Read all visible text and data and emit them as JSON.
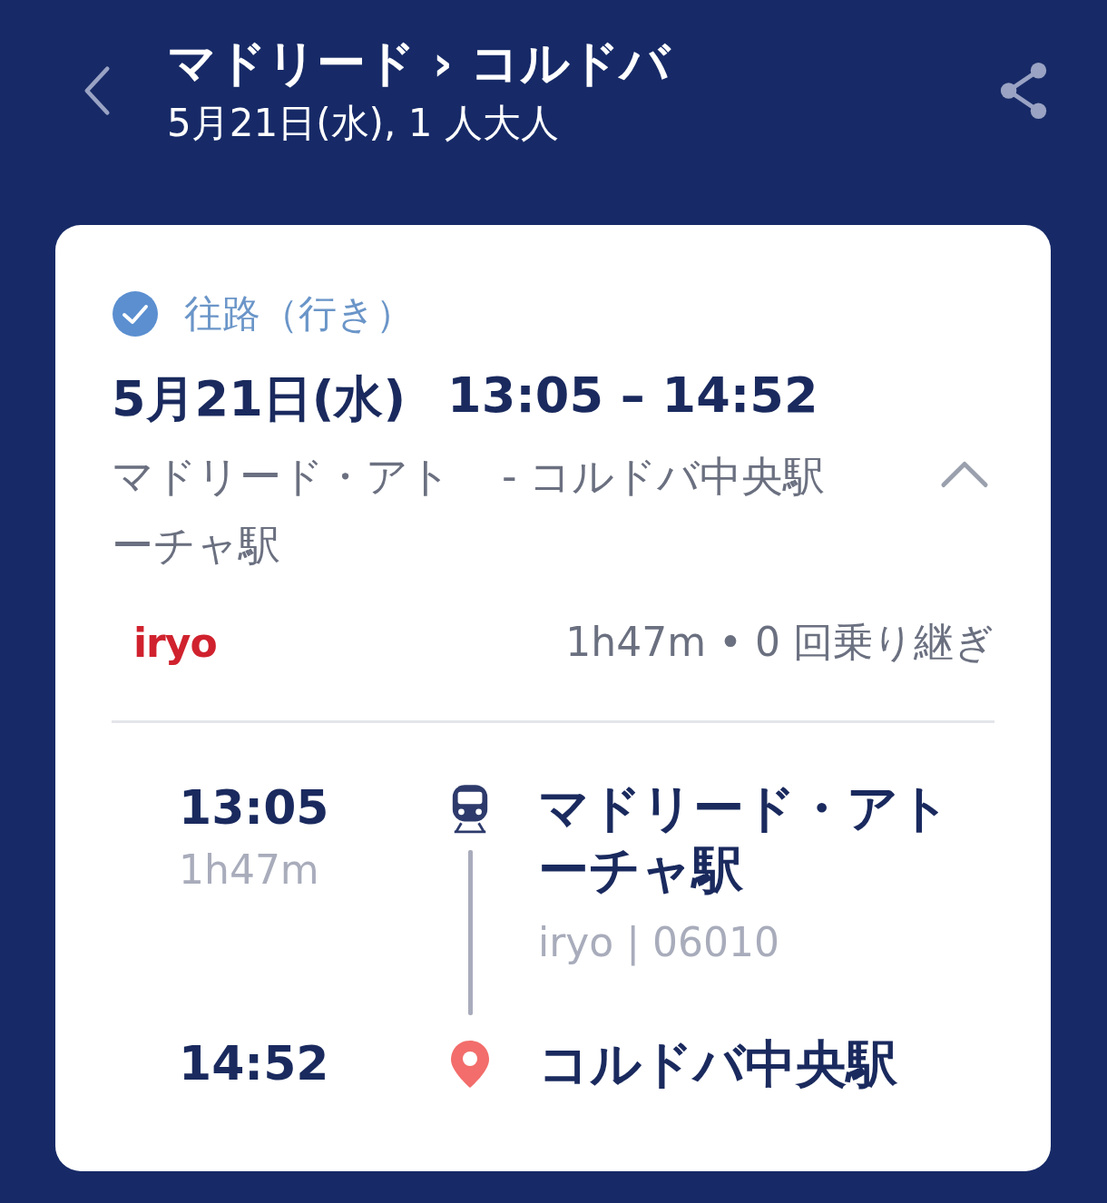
{
  "header": {
    "title": "マドリード › コルドバ",
    "subtitle": "5月21日(水), 1 人大人"
  },
  "leg": {
    "label": "往路（行き）",
    "confirmed": true,
    "date": "5月21日(水)",
    "times": "13:05 – 14:52",
    "from": "マドリード・アトーチャ駅",
    "separator": "-",
    "to": "コルドバ中央駅",
    "expanded": true,
    "operator": "iryo",
    "summary": "1h47m • 0 回乗り継ぎ"
  },
  "stops": [
    {
      "kind": "departure",
      "time": "13:05",
      "duration": "1h47m",
      "station": "マドリード・アトーチャ駅",
      "detail": "iryo | 06010"
    },
    {
      "kind": "arrival",
      "time": "14:52",
      "station": "コルドバ中央駅"
    }
  ]
}
